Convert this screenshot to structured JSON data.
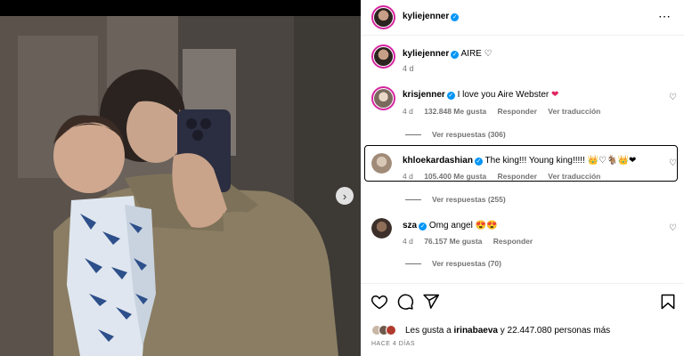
{
  "post": {
    "author": "kyliejenner",
    "more_icon": "⋯",
    "caption": "AIRE",
    "caption_emoji": "♡",
    "caption_age": "4 d"
  },
  "comments": [
    {
      "user": "krisjenner",
      "text": "I love you Aire Webster",
      "emoji": "❤",
      "age": "4 d",
      "likes": "132.848 Me gusta",
      "reply_label": "Responder",
      "translate_label": "Ver traducción",
      "replies": "Ver respuestas (306)"
    },
    {
      "user": "khloekardashian",
      "text": "The king!!! Young king!!!!!",
      "emoji": "👑♡🐐👑❤",
      "age": "4 d",
      "likes": "105.400 Me gusta",
      "reply_label": "Responder",
      "translate_label": "Ver traducción",
      "replies": "Ver respuestas (255)"
    },
    {
      "user": "sza",
      "text": "Omg angel",
      "emoji": "😍😍",
      "age": "4 d",
      "likes": "76.157 Me gusta",
      "reply_label": "Responder",
      "replies": "Ver respuestas (70)"
    }
  ],
  "likes_summary": {
    "prefix": "Les gusta a",
    "user": "irinabaeva",
    "suffix": "y 22.447.080 personas más"
  },
  "date": "HACE 4 DÍAS",
  "colors": {
    "verified": "#0095f6",
    "story_ring": "#d6249f",
    "heart_red": "#e0245e",
    "meta_gray": "#737373"
  },
  "icons": {
    "like": "heart-icon",
    "comment": "comment-icon",
    "share": "share-icon",
    "save": "bookmark-icon",
    "next": "chevron-right-icon"
  }
}
